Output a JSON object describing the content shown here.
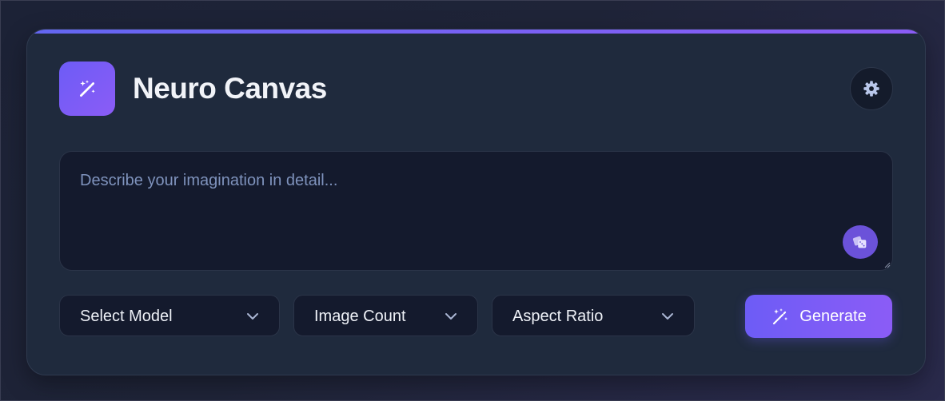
{
  "app": {
    "title": "Neuro Canvas",
    "logo_icon": "magic-wand-sparkles-icon",
    "settings_icon": "gear-icon"
  },
  "prompt": {
    "placeholder": "Describe your imagination in detail...",
    "value": "",
    "enhance_icon": "dice-icon"
  },
  "controls": {
    "model": {
      "label": "Select Model",
      "icon": "chevron-down-icon"
    },
    "image_count": {
      "label": "Image Count",
      "icon": "chevron-down-icon"
    },
    "aspect_ratio": {
      "label": "Aspect Ratio",
      "icon": "chevron-down-icon"
    },
    "generate": {
      "label": "Generate",
      "icon": "magic-wand-sparkles-icon"
    }
  },
  "colors": {
    "accent_start": "#6366f1",
    "accent_end": "#8b5cf6",
    "card_bg": "#1f2a3d",
    "input_bg": "#141a2d",
    "placeholder": "#7f93bd"
  }
}
